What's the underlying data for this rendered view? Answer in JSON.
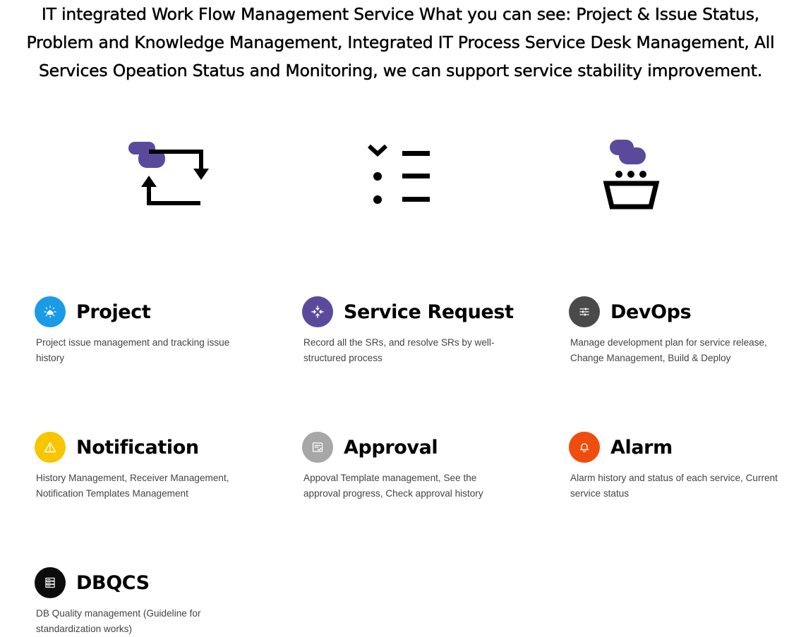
{
  "headline": {
    "line1": "IT integrated Work Flow Management Service What you can see: Project & Issue Status,",
    "line2": "Problem and Knowledge Management, Integrated IT Process Service Desk Management, All",
    "line3": "Services Opeation Status and Monitoring, we can support service stability improvement."
  },
  "hero_icons": [
    "workflow-cycle-icon",
    "process-list-icon",
    "service-operation-icon"
  ],
  "colors": {
    "hero_accent": "#5B4A9C",
    "project": "#1A9BE6",
    "service_request": "#5B4A9C",
    "devops": "#4A4A4A",
    "notification": "#F7C600",
    "approval": "#A7A7A7",
    "alarm": "#EE4D0E",
    "dbqcs": "#0C0C0C"
  },
  "features": [
    {
      "title": "Project",
      "desc": "Project issue management and tracking issue history",
      "icon": "cloud-sparkle-icon"
    },
    {
      "title": "Service Request",
      "desc": "Record all the SRs, and resolve SRs by well-structured process",
      "icon": "arrows-converge-icon"
    },
    {
      "title": "DevOps",
      "desc": "Manage development plan for service release, Change Management, Build & Deploy",
      "icon": "sliders-icon"
    },
    {
      "title": "Notification",
      "desc": "History Management, Receiver Management, Notification Templates Management",
      "icon": "warning-icon"
    },
    {
      "title": "Approval",
      "desc": "Appoval Template management, See the approval progress, Check approval history",
      "icon": "document-check-icon"
    },
    {
      "title": "Alarm",
      "desc": "Alarm history and status of each service, Current service status",
      "icon": "bell-icon"
    },
    {
      "title": "DBQCS",
      "desc": "DB Quality management (Guideline for standardization works)",
      "icon": "database-server-icon"
    }
  ]
}
